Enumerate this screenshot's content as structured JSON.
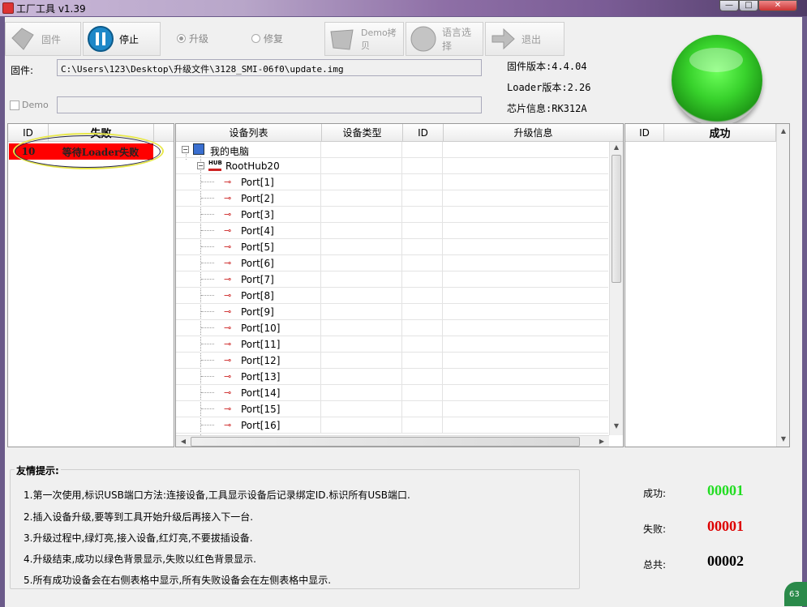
{
  "window": {
    "title": "工厂工具 v1.39"
  },
  "toolbar": {
    "firmware_label": "固件",
    "stop_label": "停止",
    "upgrade_label": "升级",
    "repair_label": "修复",
    "demo_copy_label": "Demo拷贝",
    "language_label": "语言选择",
    "exit_label": "退出"
  },
  "firmware": {
    "label": "固件:",
    "path": "C:\\Users\\123\\Desktop\\升级文件\\3128_SMI-06f0\\update.img"
  },
  "demo": {
    "label": "Demo"
  },
  "info": {
    "fw_version": "固件版本:4.4.04",
    "loader_version": "Loader版本:2.26",
    "chip_info": "芯片信息:RK312A"
  },
  "status_light": {
    "color": "#2fc628"
  },
  "fail_table": {
    "headers": {
      "id": "ID",
      "status": "失败"
    },
    "rows": [
      {
        "id": "10",
        "status": "等待Loader失败"
      }
    ],
    "row_color": "#ff0000"
  },
  "device_table": {
    "headers": [
      "设备列表",
      "设备类型",
      "ID",
      "升级信息"
    ],
    "root": "我的电脑",
    "hub": "RootHub20",
    "hub_badge": "HUB",
    "ports": [
      "Port[1]",
      "Port[2]",
      "Port[3]",
      "Port[4]",
      "Port[5]",
      "Port[6]",
      "Port[7]",
      "Port[8]",
      "Port[9]",
      "Port[10]",
      "Port[11]",
      "Port[12]",
      "Port[13]",
      "Port[14]",
      "Port[15]",
      "Port[16]"
    ]
  },
  "success_table": {
    "headers": {
      "id": "ID",
      "status": "成功"
    }
  },
  "hints": {
    "title": "友情提示:",
    "lines": [
      "1.第一次使用,标识USB端口方法:连接设备,工具显示设备后记录绑定ID.标识所有USB端口.",
      "2.插入设备升级,要等到工具开始升级后再接入下一台.",
      "3.升级过程中,绿灯亮,接入设备,红灯亮,不要拔插设备.",
      "4.升级结束,成功以绿色背景显示,失败以红色背景显示.",
      "5.所有成功设备会在右侧表格中显示,所有失败设备会在左侧表格中显示."
    ]
  },
  "stats": {
    "success_label": "成功:",
    "success_value": "00001",
    "success_color": "#22dd22",
    "fail_label": "失败:",
    "fail_value": "00001",
    "fail_color": "#dd0000",
    "total_label": "总共:",
    "total_value": "00002"
  },
  "taskbar_badge": "63"
}
